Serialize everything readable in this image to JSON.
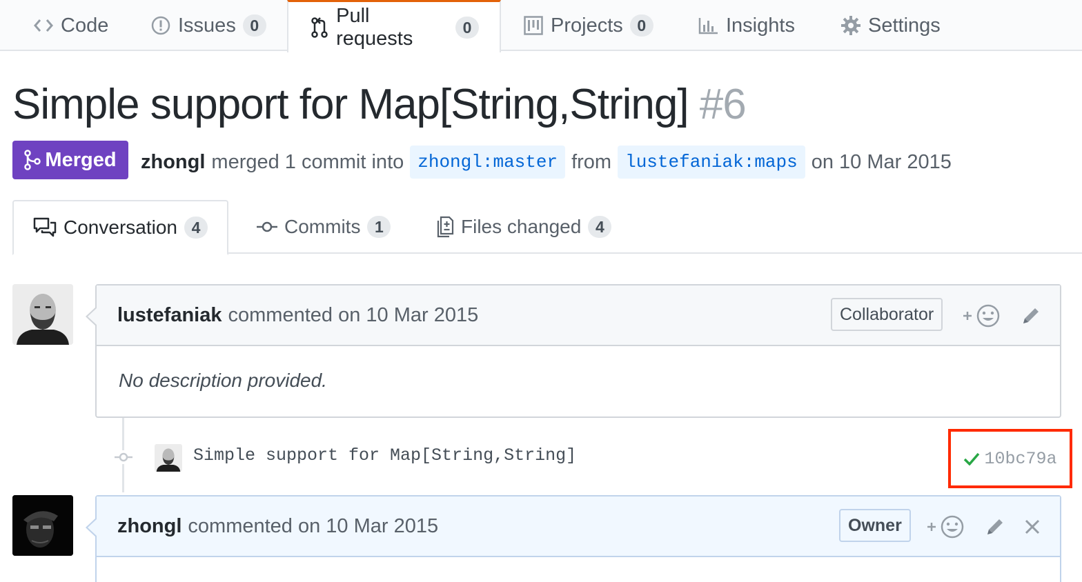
{
  "reponav": {
    "items": [
      {
        "label": "Code",
        "icon": "code-icon",
        "count": null
      },
      {
        "label": "Issues",
        "icon": "issue-opened-icon",
        "count": "0"
      },
      {
        "label": "Pull requests",
        "icon": "git-pull-request-icon",
        "count": "0",
        "selected": true
      },
      {
        "label": "Projects",
        "icon": "project-icon",
        "count": "0"
      },
      {
        "label": "Insights",
        "icon": "graph-icon",
        "count": null
      },
      {
        "label": "Settings",
        "icon": "gear-icon",
        "count": null
      }
    ]
  },
  "pr": {
    "title": "Simple support for Map[String,String]",
    "number": "#6",
    "state": "Merged",
    "author": "zhongl",
    "merged_text": "merged 1 commit into",
    "base_branch": "zhongl:master",
    "from_text": "from",
    "head_branch": "lustefaniak:maps",
    "date_text": "on 10 Mar 2015"
  },
  "tabs": [
    {
      "label": "Conversation",
      "count": "4",
      "icon": "comment-discussion-icon",
      "selected": true
    },
    {
      "label": "Commits",
      "count": "1",
      "icon": "git-commit-icon"
    },
    {
      "label": "Files changed",
      "count": "4",
      "icon": "diff-icon"
    }
  ],
  "timeline": {
    "comments": [
      {
        "author": "lustefaniak",
        "action": "commented on 10 Mar 2015",
        "role": "Collaborator",
        "body": "No description provided."
      },
      {
        "author": "zhongl",
        "action": "commented on 10 Mar 2015",
        "role": "Owner"
      }
    ],
    "commit": {
      "message": "Simple support for Map[String,String]",
      "sha": "10bc79a",
      "status": "success"
    }
  },
  "colors": {
    "merged": "#6f42c1",
    "link": "#0366d6",
    "success": "#28a745",
    "highlight_box": "#ff2a00"
  }
}
